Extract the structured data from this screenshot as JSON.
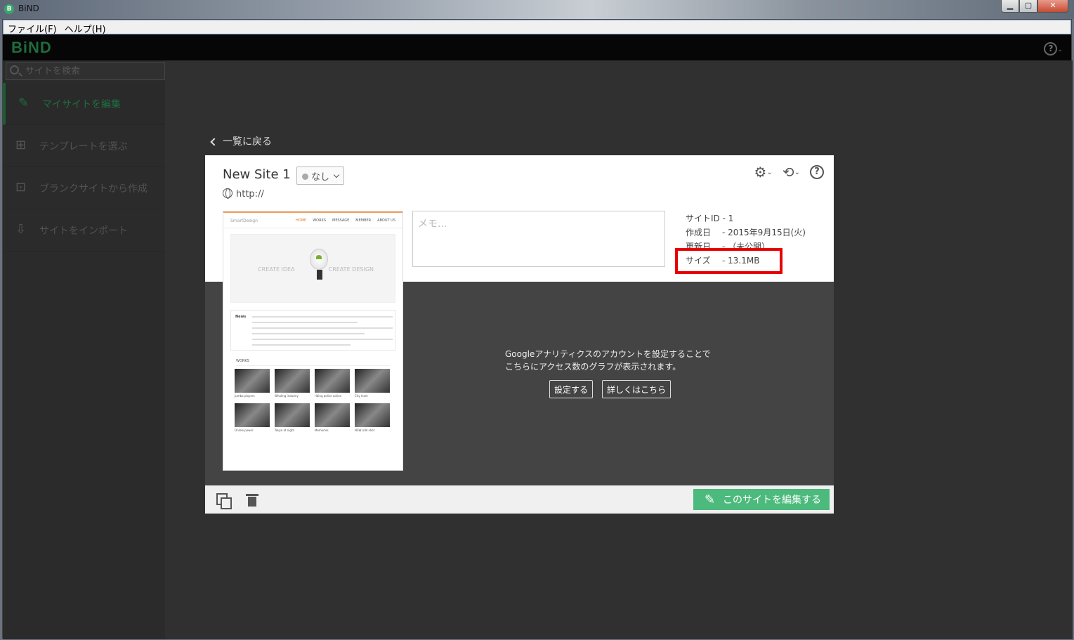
{
  "window": {
    "title": "BiND",
    "app_icon": "B",
    "minimize": "▁",
    "maximize": "▢",
    "close": "✕"
  },
  "menu": [
    "ファイル(F)",
    "ヘルプ(H)"
  ],
  "header": {
    "logo": "BiND",
    "help_icon": "?"
  },
  "sidebar": {
    "search_placeholder": "サイトを検索",
    "items": [
      {
        "label": "マイサイトを編集",
        "icon": "pencil-icon",
        "glyph": "✎",
        "active": true
      },
      {
        "label": "テンプレートを選ぶ",
        "icon": "template-add-icon",
        "glyph": "⊞",
        "active": false
      },
      {
        "label": "ブランクサイトから作成",
        "icon": "blank-add-icon",
        "glyph": "⊡",
        "active": false
      },
      {
        "label": "サイトをインポート",
        "icon": "import-icon",
        "glyph": "⇩",
        "active": false
      }
    ]
  },
  "back_label": "一覧に戻る",
  "site": {
    "name": "New Site 1",
    "status": "なし",
    "url": "http://",
    "memo_placeholder": "メモ...",
    "info": {
      "site_id_label": "サイトID",
      "site_id": "- 1",
      "created_label": "作成日",
      "created": "- 2015年9月15日(火)",
      "updated_label": "更新日",
      "updated": "- （未公開）",
      "size_label": "サイズ",
      "size": "- 13.1MB"
    }
  },
  "thumbnail": {
    "brand": "SmartDesign",
    "nav": [
      "HOME",
      "WORKS",
      "MESSAGE",
      "MEMBER",
      "ABOUT US"
    ],
    "hero_left": "CREATE IDEA",
    "hero_right": "CREATE DESIGN",
    "news_label": "News",
    "works_label": "WORKS",
    "works": [
      "Jumbo players",
      "Whaling industry",
      "riding police action",
      "City tram",
      "Online power",
      "Tokyo at night",
      "Memories",
      "NSW odd shot"
    ]
  },
  "analytics": {
    "line1": "Googleアナリティクスのアカウントを設定することで",
    "line2": "こちらにアクセス数のグラフが表示されます。",
    "setup_label": "設定する",
    "details_label": "詳しくはこちら"
  },
  "toolbar": {
    "gear": "⚙",
    "history": "⟲",
    "caret": "⌄",
    "help": "?"
  },
  "edit_button": {
    "label": "このサイトを編集する",
    "glyph": "✎"
  },
  "colors": {
    "accent": "#4cba7c",
    "highlight": "#e80000",
    "logo": "#1e6b3d"
  }
}
